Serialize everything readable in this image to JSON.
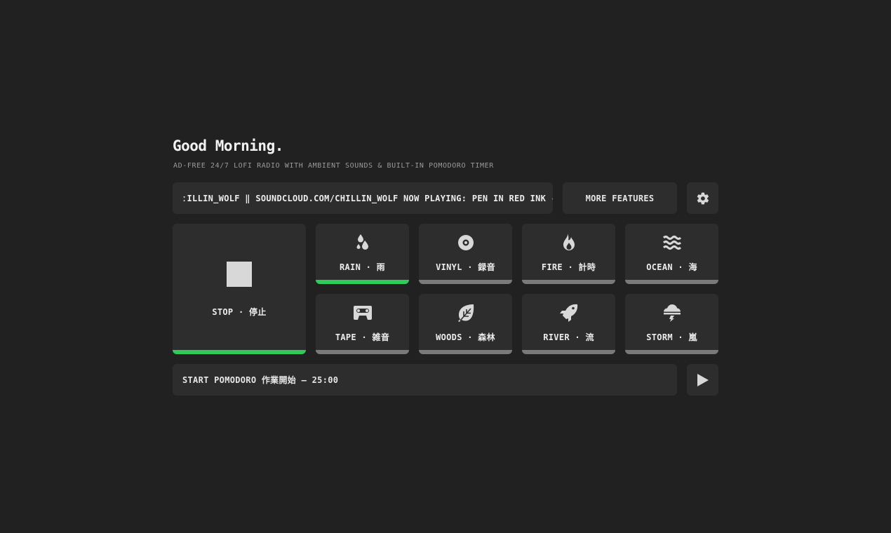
{
  "header": {
    "greeting": "Good Morning.",
    "subtitle": "AD-FREE 24/7 LOFI RADIO WITH AMBIENT SOUNDS & BUILT-IN POMODORO TIMER"
  },
  "ticker": {
    "text": "ːILLIN_WOLF ‖ SOUNDCLOUD.COM/CHILLIN_WOLF  NOW PLAYING: PEN IN RED INK -"
  },
  "toolbar": {
    "more_label": "MORE FEATURES",
    "settings_icon": "gear-icon"
  },
  "stop": {
    "label": "STOP  ·  停止",
    "active": true,
    "icon": "stop-square-icon"
  },
  "sounds": [
    {
      "label": "RAIN  ·  雨",
      "icon": "raindrops-icon",
      "active": true
    },
    {
      "label": "VINYL  ·  録音",
      "icon": "vinyl-record-icon",
      "active": false
    },
    {
      "label": "FIRE  ·  計時",
      "icon": "fire-icon",
      "active": false
    },
    {
      "label": "OCEAN  ·  海",
      "icon": "waves-icon",
      "active": false
    },
    {
      "label": "TAPE  ·  雑音",
      "icon": "cassette-tape-icon",
      "active": false
    },
    {
      "label": "WOODS  ·  森林",
      "icon": "leaf-icon",
      "active": false
    },
    {
      "label": "RIVER  ·  流",
      "icon": "fish-icon",
      "active": false
    },
    {
      "label": "STORM  ·  嵐",
      "icon": "storm-cloud-icon",
      "active": false
    }
  ],
  "pomodoro": {
    "label": "START POMODORO 作業開始 — 25:00",
    "play_icon": "play-icon"
  },
  "colors": {
    "background": "#212121",
    "tile": "#2d2d2d",
    "accent": "#2fca5a",
    "inactive_bar": "#7a7a7a"
  }
}
